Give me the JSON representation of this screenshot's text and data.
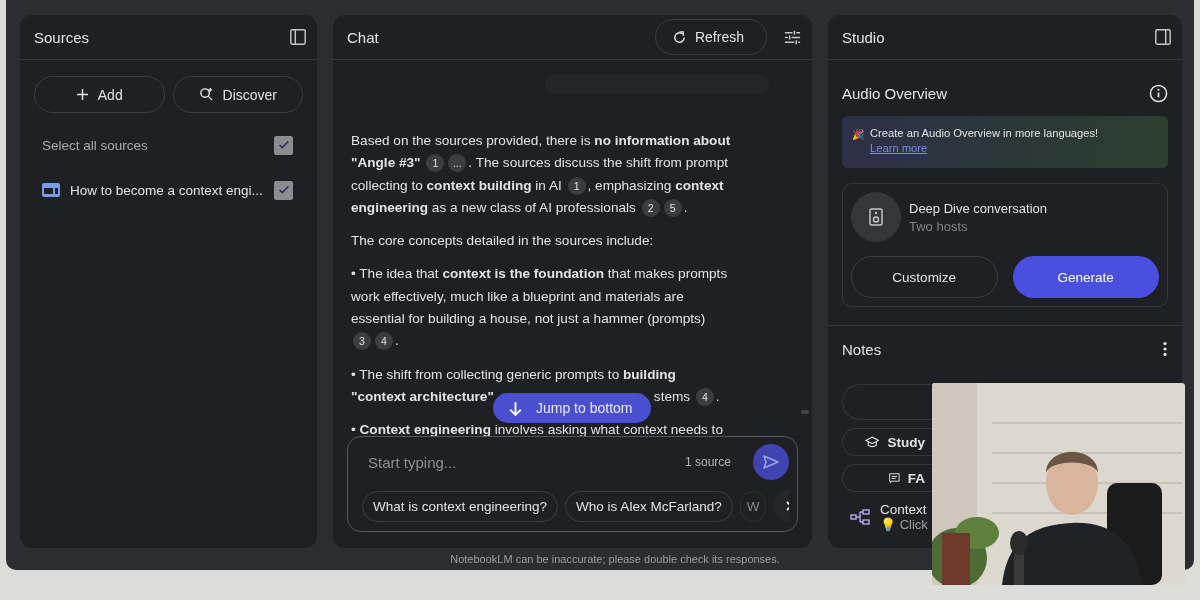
{
  "sources": {
    "title": "Sources",
    "buttons": [
      {
        "kind": "add",
        "label": "Add"
      },
      {
        "kind": "discover",
        "label": "Discover"
      }
    ],
    "select_all": {
      "label": "Select all sources",
      "checked": true
    },
    "items": [
      {
        "title": "How to become a context engi...",
        "checked": true
      }
    ]
  },
  "chat": {
    "title": "Chat",
    "refresh": "Refresh",
    "paragraphs": [
      [
        {
          "kind": "text",
          "text": "Based on the sources provided, there is **no information about \"Angle #3\"** "
        },
        {
          "kind": "cite",
          "text": "1"
        },
        {
          "kind": "cite",
          "text": "..."
        },
        {
          "kind": "text",
          "text": ". The sources discuss the shift from prompt collecting to **context building** in AI "
        },
        {
          "kind": "cite",
          "text": "1"
        },
        {
          "kind": "text",
          "text": ", emphasizing **context engineering** as a new class of AI professionals "
        },
        {
          "kind": "cite",
          "text": "2"
        },
        {
          "kind": "cite",
          "text": "5"
        },
        {
          "kind": "text",
          "text": "."
        }
      ],
      [
        {
          "kind": "text",
          "text": "The core concepts detailed in the sources include:"
        }
      ],
      [
        {
          "kind": "text",
          "text": "• The idea that **context is the foundation** that makes prompts work effectively, much like a blueprint and materials are essential for building a house, not just a hammer (prompts) "
        },
        {
          "kind": "cite",
          "text": "3"
        },
        {
          "kind": "cite",
          "text": "4"
        },
        {
          "kind": "text",
          "text": "."
        }
      ],
      [
        {
          "kind": "text",
          "text": "• The shift from collecting generic prompts to **building**"
        },
        {
          "kind": "break"
        },
        {
          "kind": "text",
          "text": "**\"context architecture\"**"
        },
        {
          "kind": "gap"
        },
        {
          "kind": "text",
          "text": "stems "
        },
        {
          "kind": "cite",
          "text": "4"
        },
        {
          "kind": "text",
          "text": "."
        }
      ],
      [
        {
          "kind": "text",
          "text": "• **Context engineering** involves asking what context needs to"
        }
      ]
    ],
    "jump": "Jump to bottom",
    "placeholder": "Start typing...",
    "source_count": "1 source",
    "suggestions": [
      "What is context engineering?",
      "Who is Alex McFarland?",
      "W"
    ],
    "disclaimer": "NotebookLM can be inaccurate; please double check its responses."
  },
  "studio": {
    "title": "Studio",
    "audio_title": "Audio Overview",
    "banner": {
      "emoji": "🎉",
      "text": "Create an Audio Overview in more languages! ",
      "link": "Learn more"
    },
    "card": {
      "title": "Deep Dive conversation",
      "subtitle": "Two hosts",
      "buttons": [
        {
          "kind": "secondary",
          "label": "Customize"
        },
        {
          "kind": "primary",
          "label": "Generate"
        }
      ]
    },
    "notes_title": "Notes",
    "note_actions": [
      {
        "kind": "blank"
      },
      {
        "kind": "study",
        "label": "Study"
      },
      {
        "kind": "faq",
        "label": "FA"
      }
    ],
    "note": {
      "title": "Context",
      "hint_icon": "💡",
      "hint": "Click"
    }
  }
}
